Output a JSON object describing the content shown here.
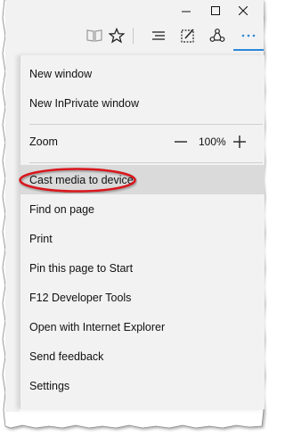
{
  "window_controls": {
    "minimize_icon": "minimize-icon",
    "maximize_icon": "maximize-icon",
    "close_icon": "close-icon"
  },
  "toolbar": {
    "icons": [
      "reading-view-icon",
      "favorites-star-icon",
      "hub-icon",
      "web-note-icon",
      "share-icon",
      "more-actions-icon"
    ],
    "accent": "#2b88d8"
  },
  "menu": {
    "new_window": "New window",
    "new_inprivate": "New InPrivate window",
    "zoom_label": "Zoom",
    "zoom_value": "100%",
    "cast": "Cast media to device",
    "find": "Find on page",
    "print": "Print",
    "pin": "Pin this page to Start",
    "f12": "F12 Developer Tools",
    "open_ie": "Open with Internet Explorer",
    "feedback": "Send feedback",
    "settings": "Settings",
    "highlight_color": "#dadada",
    "annotation_color": "#d8161b"
  }
}
